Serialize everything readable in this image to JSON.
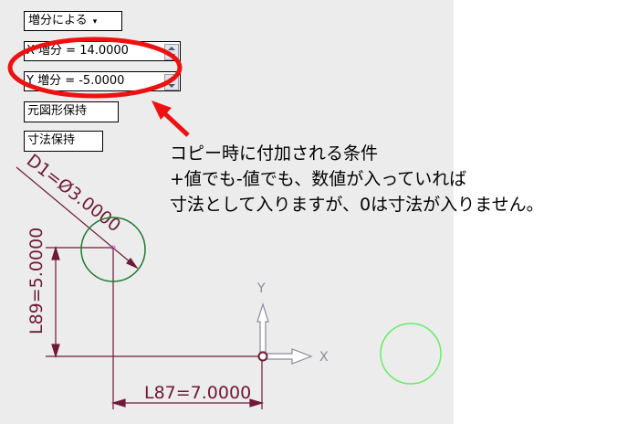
{
  "toolbar": {
    "mode_dropdown": {
      "label": "増分による",
      "arrow": "▾"
    },
    "x_increment": {
      "value": "X 増分 = 14.0000"
    },
    "y_increment": {
      "value": "Y 増分 = -5.0000"
    },
    "keep_original_button": {
      "label": "元図形保持"
    },
    "keep_dimension_button": {
      "label": "寸法保持"
    }
  },
  "callout": {
    "line1": "コピー時に付加される条件",
    "line2": "+値でも-値でも、数値が入っていれば",
    "line3": "寸法として入りますが、0は寸法が入りません。",
    "highlight_color": "#ee1111"
  },
  "drawing": {
    "diameter_label": "D1=Ø3.0000",
    "vertical_dim_label": "L89=5.0000",
    "horizontal_dim_label": "L87=7.0000",
    "axis_x_label": "X",
    "axis_y_label": "Y",
    "dimension_color": "#701838",
    "circle_color": "#1b7a2e",
    "copied_circle_color": "#66ee66",
    "axis_color": "#8a8a9a"
  }
}
